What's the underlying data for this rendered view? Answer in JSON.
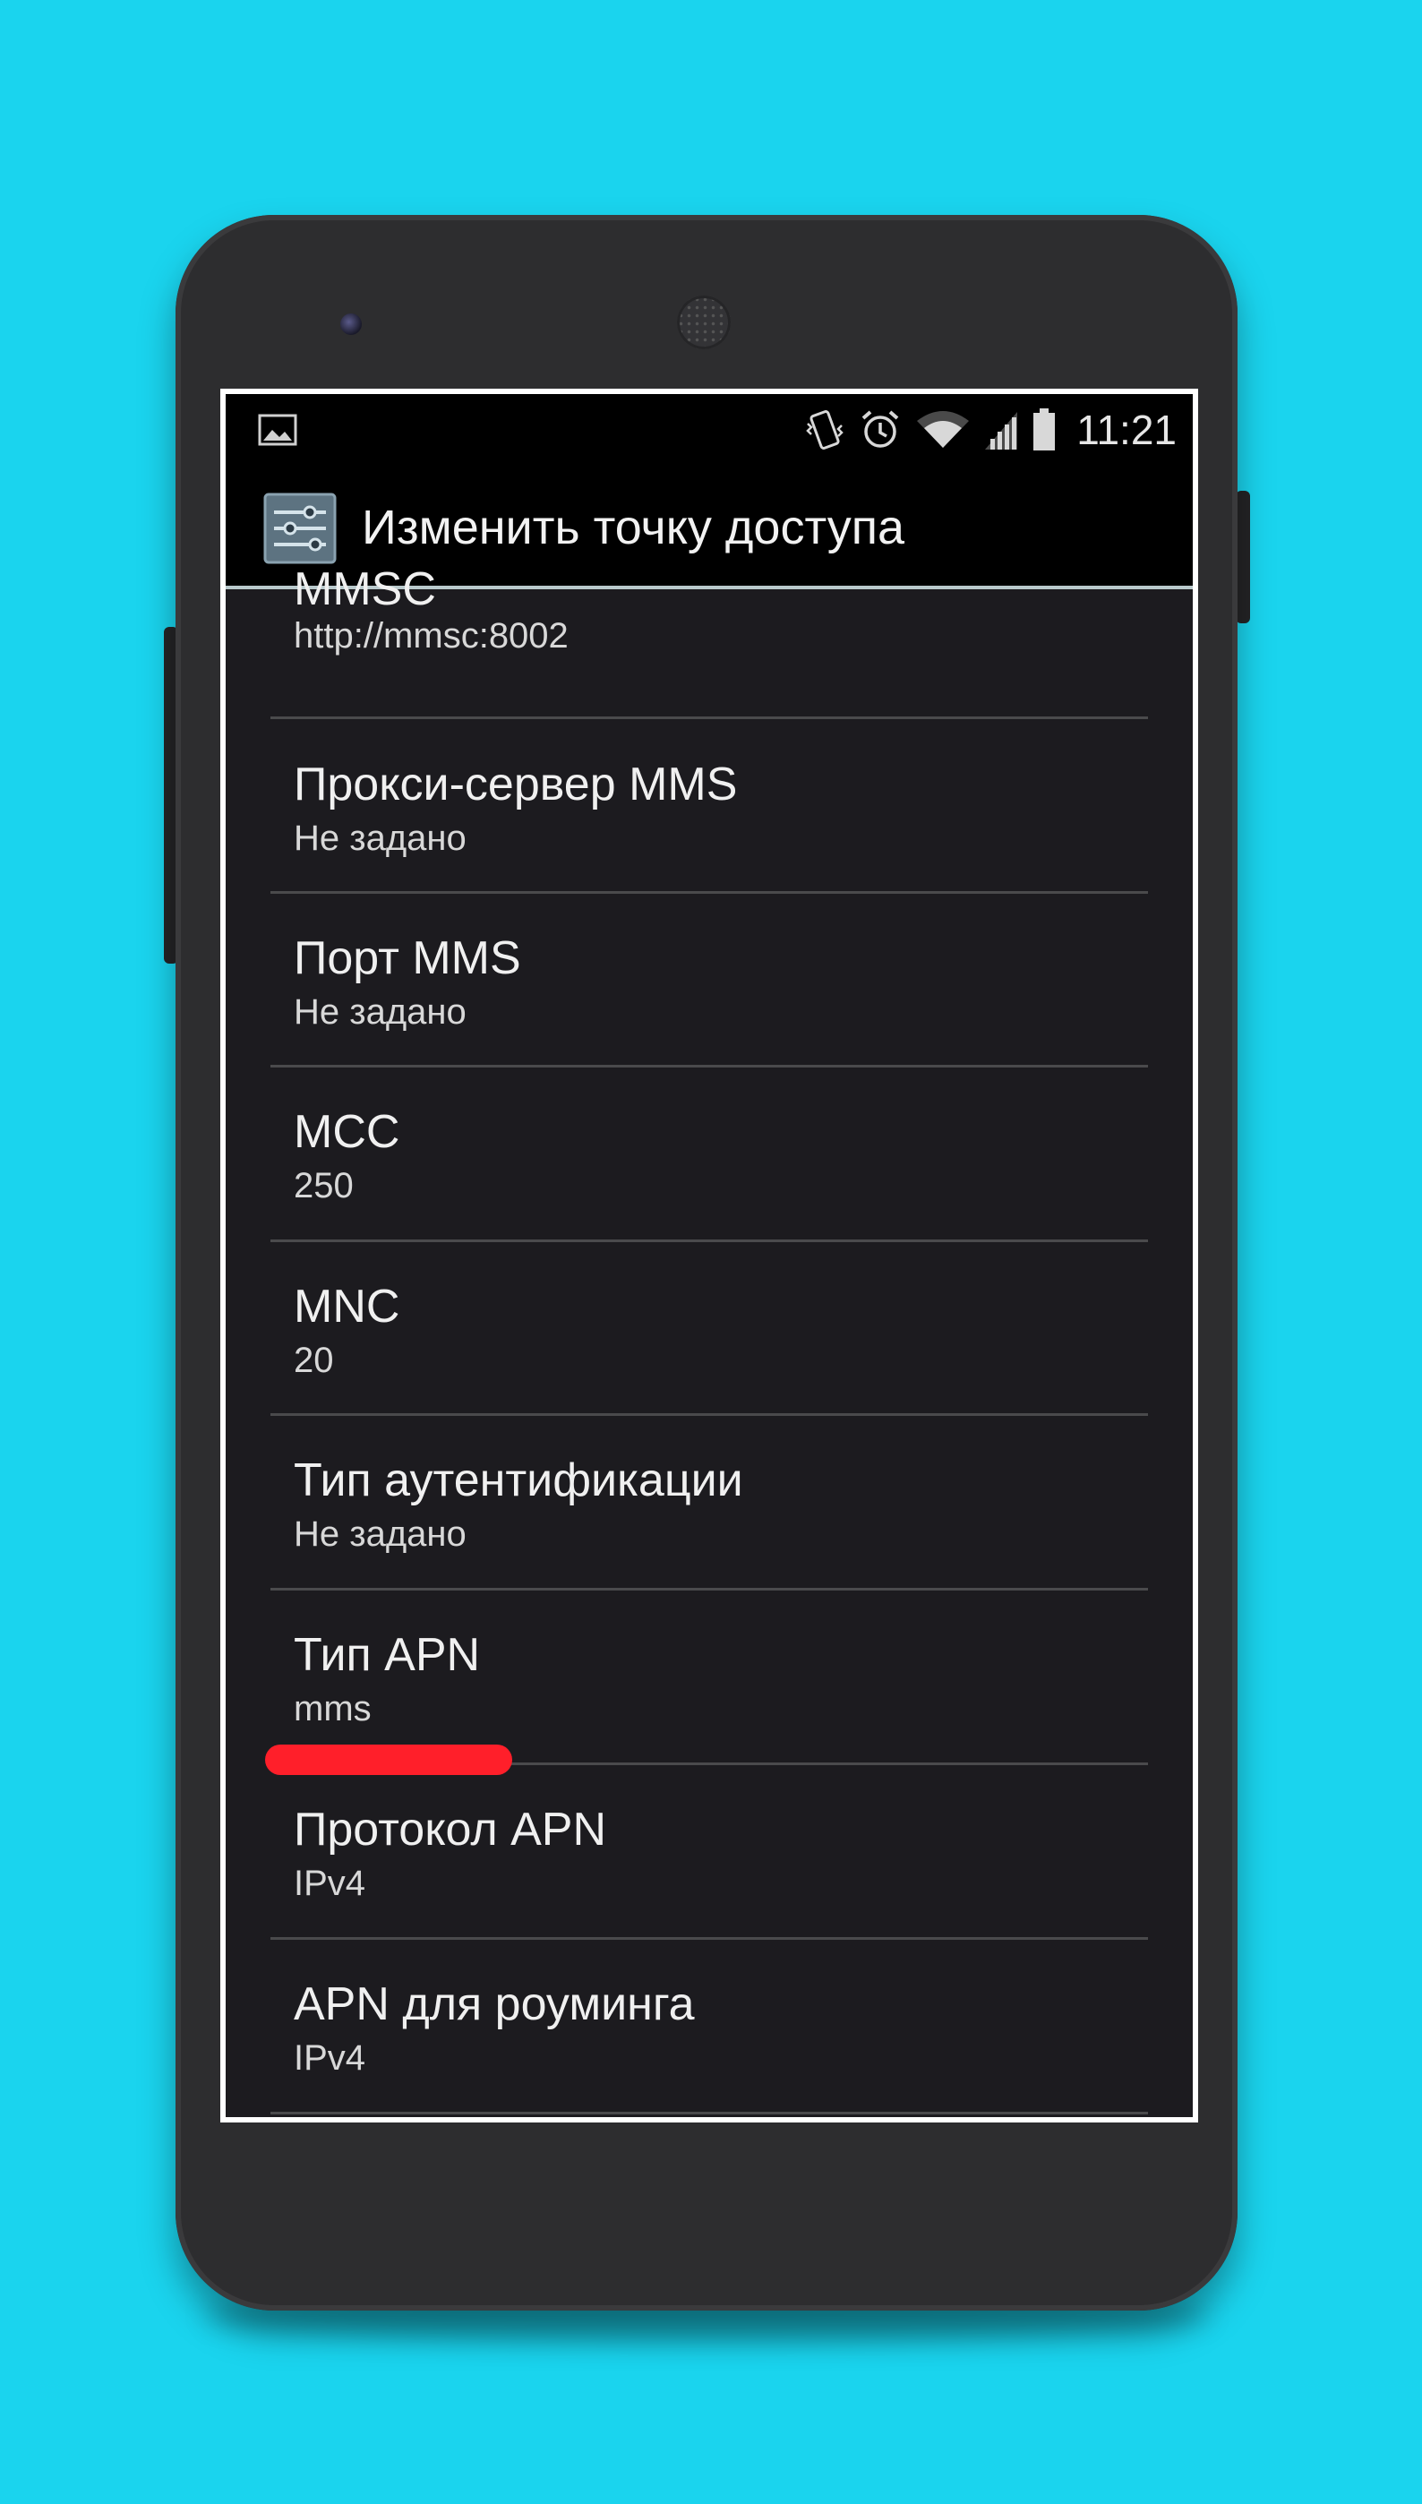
{
  "status_bar": {
    "time": "11:21",
    "icons": [
      "image-icon",
      "vibrate-icon",
      "alarm-icon",
      "wifi-icon",
      "signal-icon",
      "battery-icon"
    ]
  },
  "action_bar": {
    "title": "Изменить точку доступа",
    "icon": "settings-sliders-icon"
  },
  "preferences": [
    {
      "title": "MMSC",
      "summary": "http://mmsc:8002"
    },
    {
      "title": "Прокси-сервер MMS",
      "summary": "Не задано"
    },
    {
      "title": "Порт MMS",
      "summary": "Не задано"
    },
    {
      "title": "MCC",
      "summary": "250"
    },
    {
      "title": "MNC",
      "summary": "20"
    },
    {
      "title": "Тип аутентификации",
      "summary": "Не задано"
    },
    {
      "title": "Тип APN",
      "summary": "mms"
    },
    {
      "title": "Протокол APN",
      "summary": "IPv4"
    },
    {
      "title": "APN для роуминга",
      "summary": "IPv4"
    }
  ],
  "colors": {
    "background": "#1ad4ee",
    "phone_body": "#2d2d2f",
    "screen_bg": "#1c1b1f",
    "highlight_mark": "#ff1f2a"
  }
}
